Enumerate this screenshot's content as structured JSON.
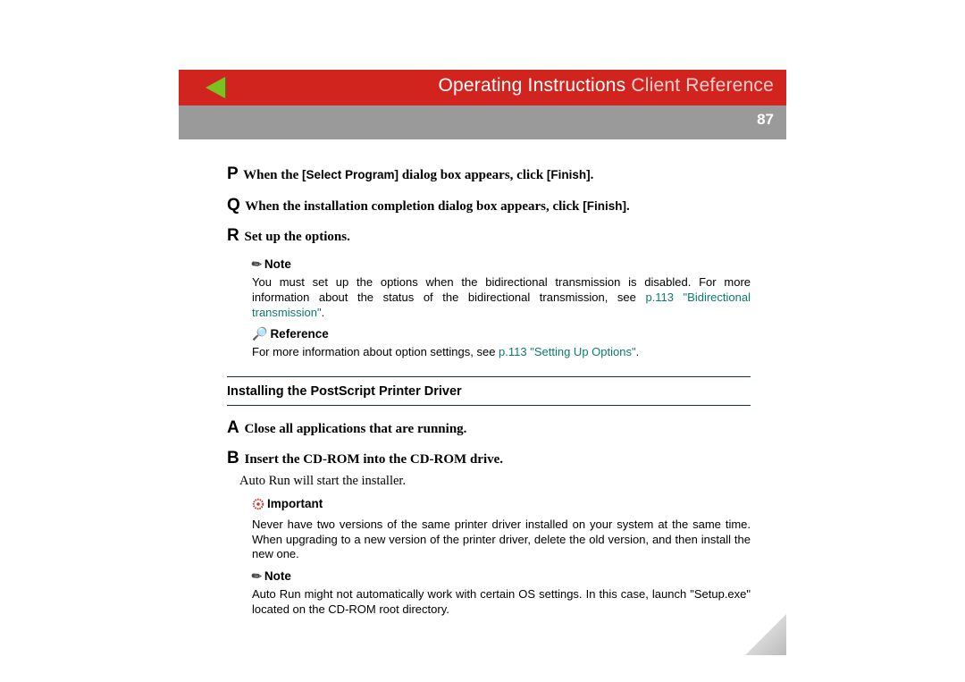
{
  "header": {
    "title_main": "Operating Instructions",
    "title_sub": "Client Reference",
    "page_number": "87"
  },
  "steps1": {
    "p": {
      "letter": "P",
      "pre": "When the ",
      "ui": "[Select Program]",
      "mid": " dialog box appears, click ",
      "ui2": "[Finish]",
      "post": "."
    },
    "q": {
      "letter": "Q",
      "pre": "When the installation completion dialog box appears, click ",
      "ui": "[Finish]",
      "post": "."
    },
    "r": {
      "letter": "R",
      "text": "Set up the options."
    }
  },
  "callouts": {
    "note_label": "Note",
    "note1_text": "You must set up the options when the bidirectional transmission is disabled. For more information about the status of the bidirectional transmission, see ",
    "note1_link": "p.113 \"Bidirectional transmission\"",
    "note1_tail": ".",
    "reference_label": "Reference",
    "reference_text": "For more information about option settings, see ",
    "reference_link": "p.113 \"Setting Up Options\"",
    "reference_tail": "."
  },
  "section": {
    "title": "Installing the PostScript Printer Driver"
  },
  "steps2": {
    "a": {
      "letter": "A",
      "text": "Close all applications that are running."
    },
    "b": {
      "letter": "B",
      "text": "Insert the CD-ROM into the CD-ROM drive."
    },
    "b_body": "Auto Run will start the installer."
  },
  "callouts2": {
    "important_label": "Important",
    "important_text": "Never have two versions of the same printer driver installed on your system at the same time. When upgrading to a new version of the printer driver, delete the old version, and then install the new one.",
    "note2_text": "Auto Run might not automatically work with certain OS settings. In this case, launch \"Setup.exe\" located on the CD-ROM root directory."
  }
}
